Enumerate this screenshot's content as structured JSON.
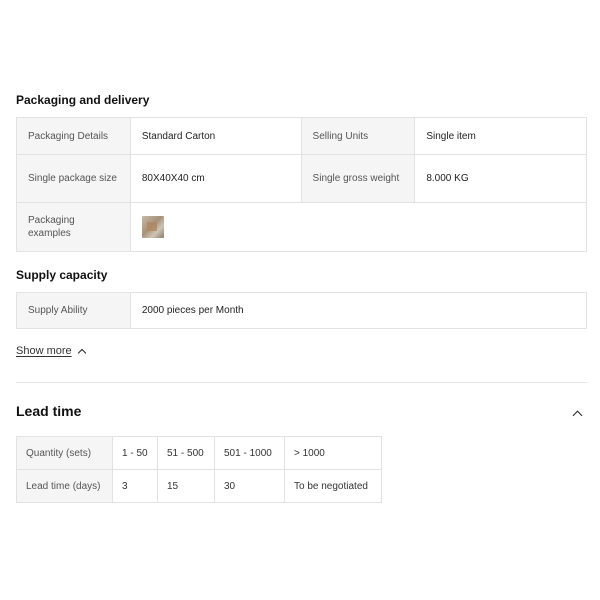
{
  "packaging": {
    "title": "Packaging and delivery",
    "details_label": "Packaging Details",
    "details_value": "Standard Carton",
    "selling_units_label": "Selling Units",
    "selling_units_value": "Single item",
    "package_size_label": "Single package size",
    "package_size_value": "80X40X40 cm",
    "gross_weight_label": "Single gross weight",
    "gross_weight_value": "8.000 KG",
    "examples_label": "Packaging examples"
  },
  "supply": {
    "title": "Supply capacity",
    "ability_label": "Supply Ability",
    "ability_value": "2000 pieces per Month"
  },
  "show_more": {
    "label": "Show more",
    "icon": "chevron-up-icon"
  },
  "lead_time": {
    "title": "Lead time",
    "toggle_icon": "chevron-up-icon",
    "quantity_label": "Quantity (sets)",
    "lead_label": "Lead time (days)",
    "quantities": [
      "1 - 50",
      "51 - 500",
      "501 - 1000",
      "> 1000"
    ],
    "days": [
      "3",
      "15",
      "30",
      "To be negotiated"
    ]
  }
}
